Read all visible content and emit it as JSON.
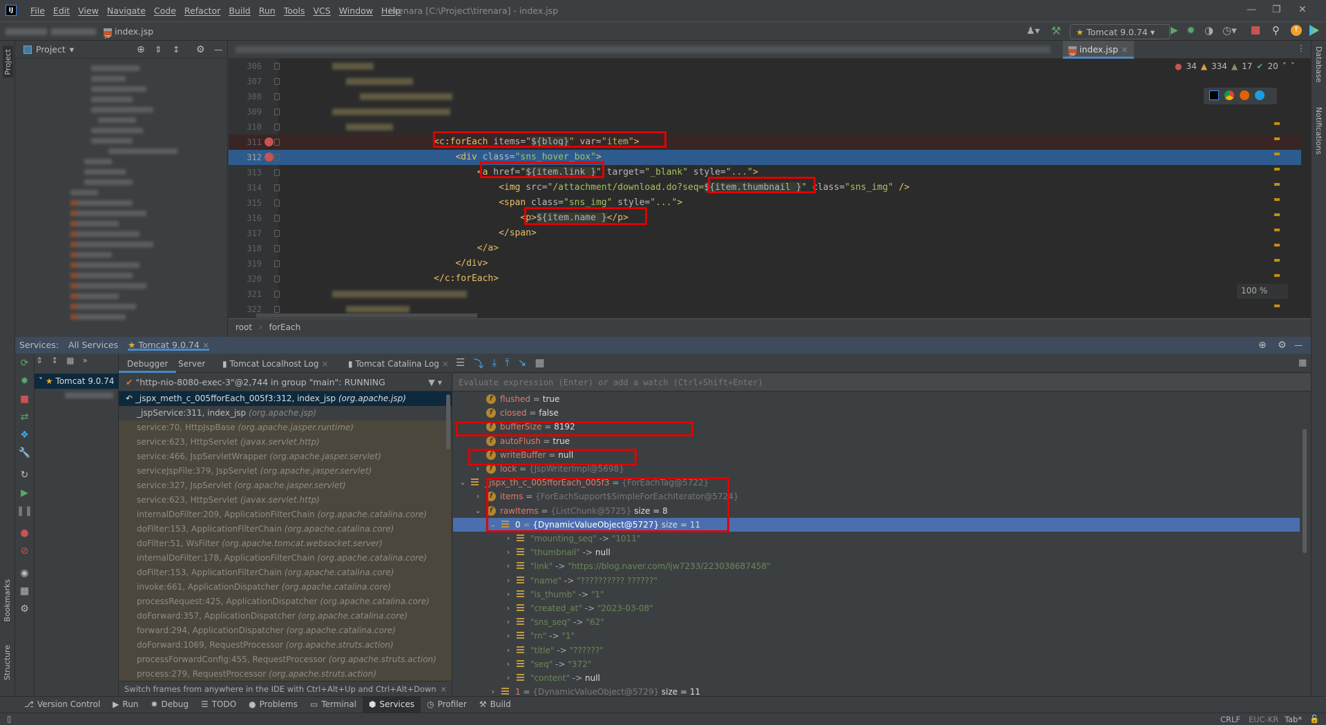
{
  "titlebar": {
    "menu": [
      "File",
      "Edit",
      "View",
      "Navigate",
      "Code",
      "Refactor",
      "Build",
      "Run",
      "Tools",
      "VCS",
      "Window",
      "Help"
    ],
    "title": "tirenara [C:\\Project\\tirenara] - index.jsp",
    "logo": "IJ"
  },
  "navbar": {
    "file": "index.jsp",
    "run_config": "Tomcat 9.0.74"
  },
  "project": {
    "title": "Project"
  },
  "left_strip": {
    "project": "Project",
    "bookmarks": "Bookmarks",
    "structure": "Structure"
  },
  "right_strip": {
    "database": "Database",
    "notifications": "Notifications"
  },
  "editor": {
    "tab": "index.jsp",
    "inspections": {
      "errors": "34",
      "warnings": "334",
      "weak_warnings": "17",
      "ok": "20"
    },
    "zoom": "100 %",
    "breadcrumb": [
      "root",
      "forEach"
    ],
    "lines": [
      {
        "n": "306",
        "redacted": true
      },
      {
        "n": "307",
        "redacted": true
      },
      {
        "n": "308",
        "redacted": true
      },
      {
        "n": "309",
        "redacted": true
      },
      {
        "n": "310",
        "redacted": true
      },
      {
        "n": "311",
        "bp": true,
        "style": "bpline",
        "tokens": [
          [
            "                            ",
            "pun"
          ],
          [
            "<c:forEach ",
            "tag"
          ],
          [
            "items=",
            "attr"
          ],
          [
            "\"",
            "val"
          ],
          [
            "${blog}",
            "el"
          ],
          [
            "\" ",
            "val"
          ],
          [
            "var=",
            "attr"
          ],
          [
            "\"item\"",
            "val"
          ],
          [
            ">",
            "tag"
          ]
        ]
      },
      {
        "n": "312",
        "bp": true,
        "style": "current",
        "tokens": [
          [
            "                                ",
            "pun"
          ],
          [
            "<div ",
            "tag"
          ],
          [
            "class=",
            "attr"
          ],
          [
            "\"sns_hover_box\"",
            "val"
          ],
          [
            ">",
            "tag"
          ]
        ]
      },
      {
        "n": "313",
        "tokens": [
          [
            "                                    ",
            "pun"
          ],
          [
            "<a ",
            "tag"
          ],
          [
            "href=",
            "attr"
          ],
          [
            "\"",
            "val"
          ],
          [
            "${item.link }",
            "el"
          ],
          [
            "\" ",
            "val"
          ],
          [
            "target=",
            "attr"
          ],
          [
            "\"_blank\" ",
            "val"
          ],
          [
            "style=",
            "attr"
          ],
          [
            "\"...\"",
            "val"
          ],
          [
            ">",
            "tag"
          ]
        ]
      },
      {
        "n": "314",
        "tokens": [
          [
            "                                        ",
            "pun"
          ],
          [
            "<img ",
            "tag"
          ],
          [
            "src=",
            "attr"
          ],
          [
            "\"/attachment/download.do?seq=",
            "val"
          ],
          [
            "${item.thumbnail }",
            "el"
          ],
          [
            "\" ",
            "val"
          ],
          [
            "class=",
            "attr"
          ],
          [
            "\"sns_img\" ",
            "val"
          ],
          [
            "/>",
            "tag"
          ]
        ]
      },
      {
        "n": "315",
        "tokens": [
          [
            "                                        ",
            "pun"
          ],
          [
            "<span ",
            "tag"
          ],
          [
            "class=",
            "attr"
          ],
          [
            "\"sns_img\" ",
            "val"
          ],
          [
            "style=",
            "attr"
          ],
          [
            "\"...\"",
            "val"
          ],
          [
            ">",
            "tag"
          ]
        ]
      },
      {
        "n": "316",
        "tokens": [
          [
            "                                            ",
            "pun"
          ],
          [
            "<p>",
            "tag"
          ],
          [
            "${item.name }",
            "el"
          ],
          [
            "</p>",
            "tag"
          ]
        ]
      },
      {
        "n": "317",
        "tokens": [
          [
            "                                        ",
            "pun"
          ],
          [
            "</span>",
            "tag"
          ]
        ]
      },
      {
        "n": "318",
        "tokens": [
          [
            "                                    ",
            "pun"
          ],
          [
            "</a>",
            "tag"
          ]
        ]
      },
      {
        "n": "319",
        "tokens": [
          [
            "                                ",
            "pun"
          ],
          [
            "</div>",
            "tag"
          ]
        ]
      },
      {
        "n": "320",
        "tokens": [
          [
            "                            ",
            "pun"
          ],
          [
            "</c:forEach>",
            "tag"
          ]
        ]
      },
      {
        "n": "321",
        "redacted": true
      },
      {
        "n": "322",
        "redacted": true
      }
    ]
  },
  "services": {
    "label": "Services:",
    "tabs": [
      "All Services",
      "Tomcat 9.0.74"
    ],
    "tree": {
      "root": "Tomcat 9.0.74"
    },
    "debug_tabs": [
      "Debugger",
      "Server",
      "Tomcat Localhost Log",
      "Tomcat Catalina Log"
    ],
    "thread": "\"http-nio-8080-exec-3\"@2,744 in group \"main\": RUNNING",
    "frames": [
      {
        "m": "_jspx_meth_c_005fforEach_005f3:312, index_jsp",
        "p": "(org.apache.jsp)",
        "kind": "sel"
      },
      {
        "m": "_jspService:311, index_jsp",
        "p": "(org.apache.jsp)",
        "kind": "app"
      },
      {
        "m": "service:70, HttpJspBase",
        "p": "(org.apache.jasper.runtime)",
        "kind": "lib"
      },
      {
        "m": "service:623, HttpServlet",
        "p": "(javax.servlet.http)",
        "kind": "lib"
      },
      {
        "m": "service:466, JspServletWrapper",
        "p": "(org.apache.jasper.servlet)",
        "kind": "lib"
      },
      {
        "m": "serviceJspFile:379, JspServlet",
        "p": "(org.apache.jasper.servlet)",
        "kind": "lib"
      },
      {
        "m": "service:327, JspServlet",
        "p": "(org.apache.jasper.servlet)",
        "kind": "lib"
      },
      {
        "m": "service:623, HttpServlet",
        "p": "(javax.servlet.http)",
        "kind": "lib"
      },
      {
        "m": "internalDoFilter:209, ApplicationFilterChain",
        "p": "(org.apache.catalina.core)",
        "kind": "lib"
      },
      {
        "m": "doFilter:153, ApplicationFilterChain",
        "p": "(org.apache.catalina.core)",
        "kind": "lib"
      },
      {
        "m": "doFilter:51, WsFilter",
        "p": "(org.apache.tomcat.websocket.server)",
        "kind": "lib"
      },
      {
        "m": "internalDoFilter:178, ApplicationFilterChain",
        "p": "(org.apache.catalina.core)",
        "kind": "lib"
      },
      {
        "m": "doFilter:153, ApplicationFilterChain",
        "p": "(org.apache.catalina.core)",
        "kind": "lib"
      },
      {
        "m": "invoke:661, ApplicationDispatcher",
        "p": "(org.apache.catalina.core)",
        "kind": "lib"
      },
      {
        "m": "processRequest:425, ApplicationDispatcher",
        "p": "(org.apache.catalina.core)",
        "kind": "lib"
      },
      {
        "m": "doForward:357, ApplicationDispatcher",
        "p": "(org.apache.catalina.core)",
        "kind": "lib"
      },
      {
        "m": "forward:294, ApplicationDispatcher",
        "p": "(org.apache.catalina.core)",
        "kind": "lib"
      },
      {
        "m": "doForward:1069, RequestProcessor",
        "p": "(org.apache.struts.action)",
        "kind": "lib"
      },
      {
        "m": "processForwardConfig:455, RequestProcessor",
        "p": "(org.apache.struts.action)",
        "kind": "lib"
      },
      {
        "m": "process:279, RequestProcessor",
        "p": "(org.apache.struts.action)",
        "kind": "lib"
      }
    ],
    "frames_hint": "Switch frames from anywhere in the IDE with Ctrl+Alt+Up and Ctrl+Alt+Down",
    "eval_placeholder": "Evaluate expression (Enter) or add a watch (Ctrl+Shift+Enter)",
    "variables": [
      {
        "d": 1,
        "ic": "f",
        "name": "flushed",
        "op": " = ",
        "val": "true",
        "vc": "vval"
      },
      {
        "d": 1,
        "ic": "f",
        "name": "closed",
        "op": " = ",
        "val": "false",
        "vc": "vval"
      },
      {
        "d": 1,
        "ic": "f",
        "name": "bufferSize",
        "op": " = ",
        "val": "8192",
        "vc": "vval"
      },
      {
        "d": 1,
        "ic": "f",
        "name": "autoFlush",
        "op": " = ",
        "val": "true",
        "vc": "vval"
      },
      {
        "d": 1,
        "ic": "f",
        "name": "writeBuffer",
        "op": " = ",
        "val": "null",
        "vc": "vval"
      },
      {
        "d": 1,
        "ic": "f",
        "ex": ">",
        "name": "lock",
        "op": " = ",
        "val": "{JspWriterImpl@5698}",
        "vc": "vtype"
      },
      {
        "d": 0,
        "ic": "l",
        "ex": "v",
        "name": "_jspx_th_c_005fforEach_005f3",
        "op": " = ",
        "val": "{ForEachTag@5722}",
        "vc": "vtype"
      },
      {
        "d": 1,
        "ic": "f",
        "ex": ">",
        "name": "items",
        "op": " = ",
        "val": "{ForEachSupport$SimpleForEachIterator@5724}",
        "vc": "vtype"
      },
      {
        "d": 1,
        "ic": "f",
        "ex": "v",
        "name": "rawItems",
        "op": " = ",
        "val": "{ListChunk@5725}",
        "vc": "vtype",
        "extra": "  size = 8"
      },
      {
        "d": 2,
        "ic": "l",
        "ex": "v",
        "name": "0",
        "op": " = ",
        "val": "{DynamicValueObject@5727}",
        "vc": "vtype",
        "extra": "  size = 11",
        "sel": true
      },
      {
        "d": 3,
        "ic": "l",
        "ex": ">",
        "key": "\"mounting_seq\"",
        "op": " -> ",
        "val": "\"1011\"",
        "vc": "vstr"
      },
      {
        "d": 3,
        "ic": "l",
        "ex": ">",
        "key": "\"thumbnail\"",
        "op": " -> ",
        "val": "null",
        "vc": "vval"
      },
      {
        "d": 3,
        "ic": "l",
        "ex": ">",
        "key": "\"link\"",
        "op": " -> ",
        "val": "\"https://blog.naver.com/ljw7233/223038687458\"",
        "vc": "vstr"
      },
      {
        "d": 3,
        "ic": "l",
        "ex": ">",
        "key": "\"name\"",
        "op": " -> ",
        "val": "\"?????????? ??????\"",
        "vc": "vstr"
      },
      {
        "d": 3,
        "ic": "l",
        "ex": ">",
        "key": "\"is_thumb\"",
        "op": " -> ",
        "val": "\"1\"",
        "vc": "vstr"
      },
      {
        "d": 3,
        "ic": "l",
        "ex": ">",
        "key": "\"created_at\"",
        "op": " -> ",
        "val": "\"2023-03-08\"",
        "vc": "vstr"
      },
      {
        "d": 3,
        "ic": "l",
        "ex": ">",
        "key": "\"sns_seq\"",
        "op": " -> ",
        "val": "\"62\"",
        "vc": "vstr"
      },
      {
        "d": 3,
        "ic": "l",
        "ex": ">",
        "key": "\"rn\"",
        "op": " -> ",
        "val": "\"1\"",
        "vc": "vstr"
      },
      {
        "d": 3,
        "ic": "l",
        "ex": ">",
        "key": "\"title\"",
        "op": " -> ",
        "val": "\"??????\"",
        "vc": "vstr"
      },
      {
        "d": 3,
        "ic": "l",
        "ex": ">",
        "key": "\"seq\"",
        "op": " -> ",
        "val": "\"372\"",
        "vc": "vstr"
      },
      {
        "d": 3,
        "ic": "l",
        "ex": ">",
        "key": "\"content\"",
        "op": " -> ",
        "val": "null",
        "vc": "vval"
      },
      {
        "d": 2,
        "ic": "l",
        "ex": ">",
        "name": "1",
        "op": " = ",
        "val": "{DynamicValueObject@5729}",
        "vc": "vtype",
        "extra": "  size = 11"
      }
    ]
  },
  "bottom_tools": [
    "Version Control",
    "Run",
    "Debug",
    "TODO",
    "Problems",
    "Terminal",
    "Services",
    "Profiler",
    "Build"
  ],
  "bottom_active": "Services",
  "status": {
    "line_sep": "CRLF",
    "encoding": "EUC-KR",
    "indent": "Tab*"
  },
  "colors": {
    "accent": "#4a88c7",
    "highlight_box": "#e00000",
    "breakpoint": "#c75450",
    "current_line": "#2d5b8e"
  }
}
